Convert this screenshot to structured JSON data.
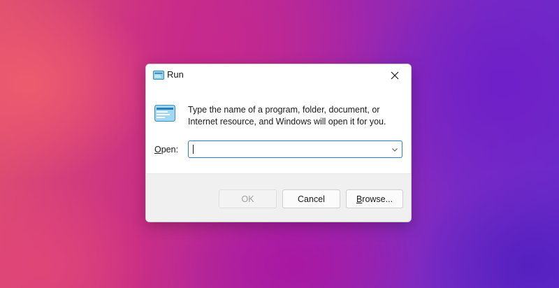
{
  "dialog": {
    "title": "Run",
    "title_icon": "run-icon",
    "close_icon": "close-icon",
    "description": "Type the name of a program, folder, document, or Internet resource, and Windows will open it for you.",
    "open_label_accel": "O",
    "open_label_rest": "pen:",
    "open_input": {
      "value": "",
      "placeholder": "",
      "dropdown_icon": "chevron-down-icon"
    },
    "buttons": {
      "ok_label": "OK",
      "ok_enabled": false,
      "cancel_label": "Cancel",
      "browse_accel": "B",
      "browse_rest": "rowse..."
    }
  },
  "colors": {
    "accent": "#2b7ed6",
    "footer_bg": "#f0f0f0",
    "disabled_text": "#a0a0a0"
  }
}
